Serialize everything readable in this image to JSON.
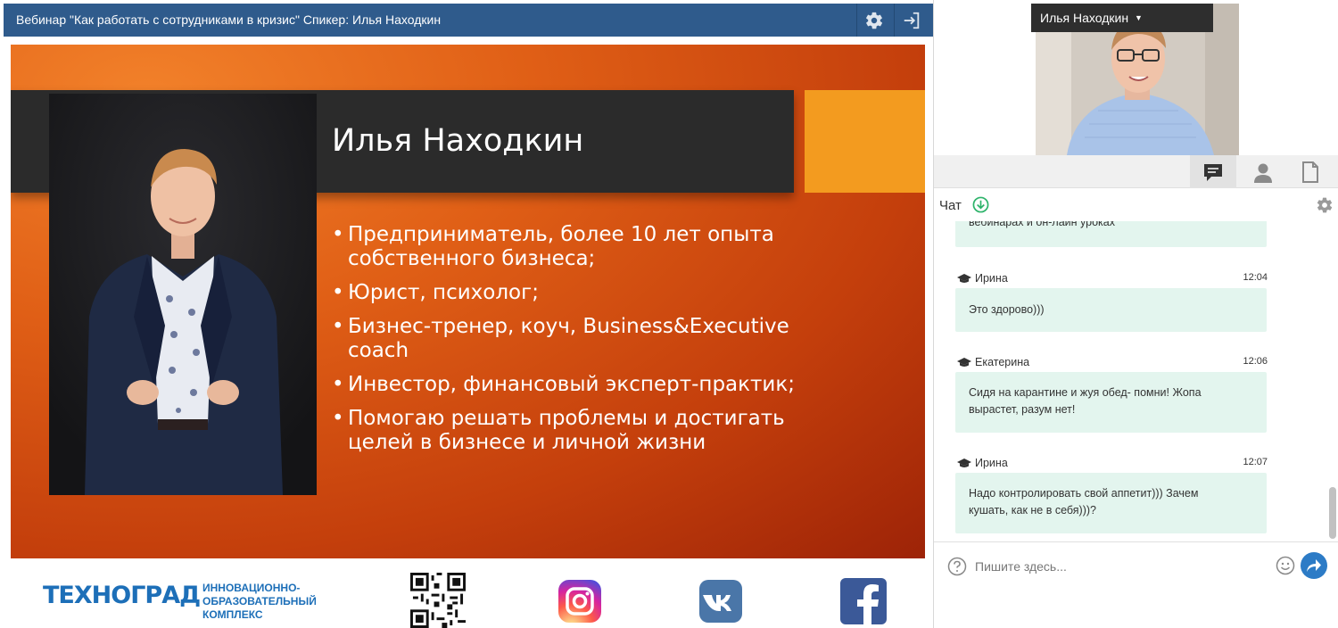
{
  "webinar": {
    "title": "Вебинар \"Как работать с сотрудниками в кризис\" Спикер: Илья Находкин",
    "settings_icon": "gear-icon",
    "exit_icon": "exit-icon"
  },
  "slide": {
    "speaker_name": "Илья Находкин",
    "bullets": [
      "Предприниматель, более 10 лет опыта собственного бизнеса;",
      "Юрист, психолог;",
      "Бизнес-тренер, коуч, Business&Executive coach",
      "Инвестор, финансовый эксперт-практик;",
      "Помогаю решать проблемы и достигать целей в бизнесе и личной жизни"
    ],
    "colors": {
      "band": "#2b2b2b",
      "accent": "#f39b1f",
      "background": "#d9521a"
    }
  },
  "footer": {
    "logo_text": "ТЕХНОГРАД",
    "org_line1": "ИННОВАЦИОННО-",
    "org_line2": "ОБРАЗОВАТЕЛЬНЫЙ",
    "org_line3": "КОМПЛЕКС",
    "icons": [
      "qr-code-icon",
      "instagram-icon",
      "vk-icon",
      "facebook-icon"
    ]
  },
  "video": {
    "speaker_dropdown": "Илья Находкин"
  },
  "panel_tabs": [
    "chat-icon",
    "user-icon",
    "file-icon"
  ],
  "chat": {
    "title": "Чат",
    "partial_message": "вебинарах и он-лайн уроках",
    "messages": [
      {
        "author": "Ирина",
        "time": "12:04",
        "text": "Это здорово)))"
      },
      {
        "author": "Екатерина",
        "time": "12:06",
        "text_line1": "Сидя на карантине и жуя обед- помни! Жопа",
        "text_line2": "вырастет, разум нет!"
      },
      {
        "author": "Ирина",
        "time": "12:07",
        "text_line1": "Надо контролировать свой аппетит))) Зачем",
        "text_line2": "кушать, как не в себя)))?"
      }
    ],
    "input_placeholder": "Пишите здесь..."
  }
}
